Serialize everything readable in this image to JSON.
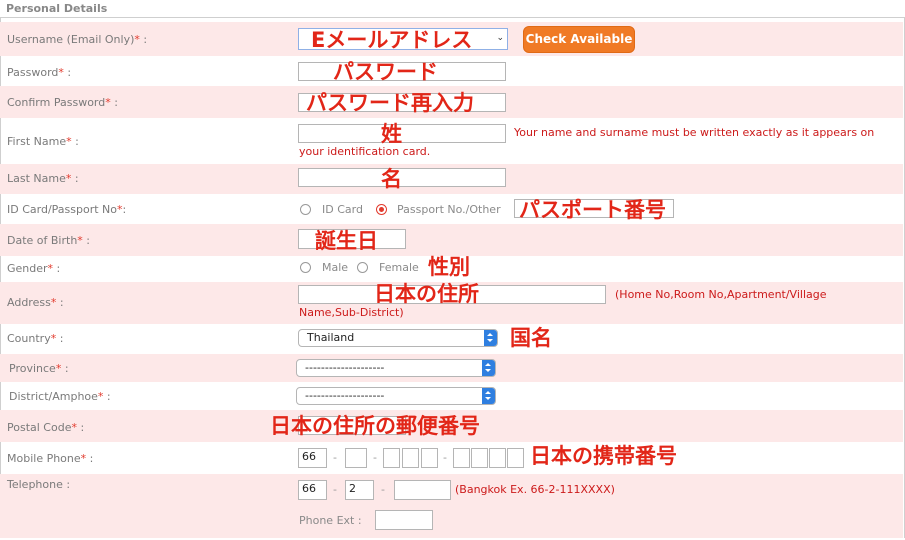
{
  "section": {
    "title": "Personal Details"
  },
  "rows": {
    "username": {
      "label": "Username (Email Only)",
      "annotation": "Eメールアドレス",
      "check_button": "Check Available"
    },
    "password": {
      "label": "Password",
      "annotation": "パスワード"
    },
    "confirm_password": {
      "label": "Confirm Password",
      "annotation": "パスワード再入力"
    },
    "first_name": {
      "label": "First Name",
      "annotation": "姓",
      "note_a": "Your name and surname must be written exactly as it appears on",
      "note_b": "your identification card."
    },
    "last_name": {
      "label": "Last Name",
      "annotation": "名"
    },
    "id_card": {
      "label": "ID Card/Passport No",
      "option_id": "ID Card",
      "option_passport": "Passport No./Other",
      "annotation": "パスポート番号"
    },
    "dob": {
      "label": "Date of Birth",
      "annotation": "誕生日"
    },
    "gender": {
      "label": "Gender",
      "option_male": "Male",
      "option_female": "Female",
      "annotation": "性別"
    },
    "address": {
      "label": "Address",
      "annotation": "日本の住所",
      "note_a": "(Home No,Room No,Apartment/Village",
      "note_b": "Name,Sub-District)"
    },
    "country": {
      "label": "Country",
      "value": "Thailand",
      "annotation": "国名"
    },
    "province": {
      "label": "Province",
      "value": "--------------------"
    },
    "district": {
      "label": "District/Amphoe",
      "value": "--------------------"
    },
    "postal": {
      "label": "Postal Code",
      "annotation": "日本の住所の郵便番号"
    },
    "mobile": {
      "label": "Mobile Phone",
      "prefix": "66",
      "annotation": "日本の携帯番号"
    },
    "telephone": {
      "label": "Telephone",
      "prefix": "66",
      "area": "2",
      "note": "(Bangkok Ex. 66-2-111XXXX)",
      "ext_label": "Phone Ext"
    }
  },
  "required_mark": "*",
  "colon": ":",
  "dash": "-",
  "colors": {
    "required": "#e23b2e",
    "annotation": "#e22618",
    "row_highlight": "#fde8e8",
    "button": "#f07a25",
    "select_arrow": "#2f7fe0"
  }
}
